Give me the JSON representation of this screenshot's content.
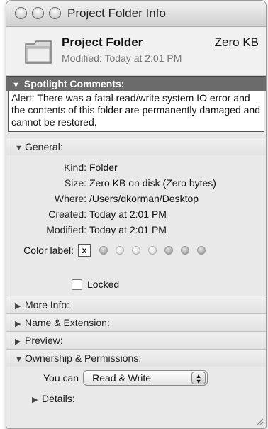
{
  "window": {
    "title": "Project Folder Info"
  },
  "header": {
    "name": "Project Folder",
    "size": "Zero KB",
    "modified": "Modified: Today at 2:01 PM"
  },
  "spotlight": {
    "label": "Spotlight Comments:",
    "text": "Alert: There was a fatal read/write system IO error and the contents of this folder are permanently damaged and cannot be restored."
  },
  "general": {
    "label": "General:",
    "rows": [
      {
        "label": "Kind:",
        "value": "Folder"
      },
      {
        "label": "Size:",
        "value": "Zero KB on disk (Zero bytes)"
      },
      {
        "label": "Where:",
        "value": "/Users/dkorman/Desktop"
      },
      {
        "label": "Created:",
        "value": "Today at 2:01 PM"
      },
      {
        "label": "Modified:",
        "value": "Today at 2:01 PM"
      }
    ],
    "color_label": "Color label:",
    "color_none": "x",
    "locked": "Locked"
  },
  "sections": {
    "more_info": "More Info:",
    "name_ext": "Name & Extension:",
    "preview": "Preview:",
    "ownership": "Ownership & Permissions:"
  },
  "permissions": {
    "you_can": "You can",
    "value": "Read & Write",
    "details": "Details:"
  },
  "icons": {
    "expanded": "▼",
    "collapsed": "▶"
  }
}
